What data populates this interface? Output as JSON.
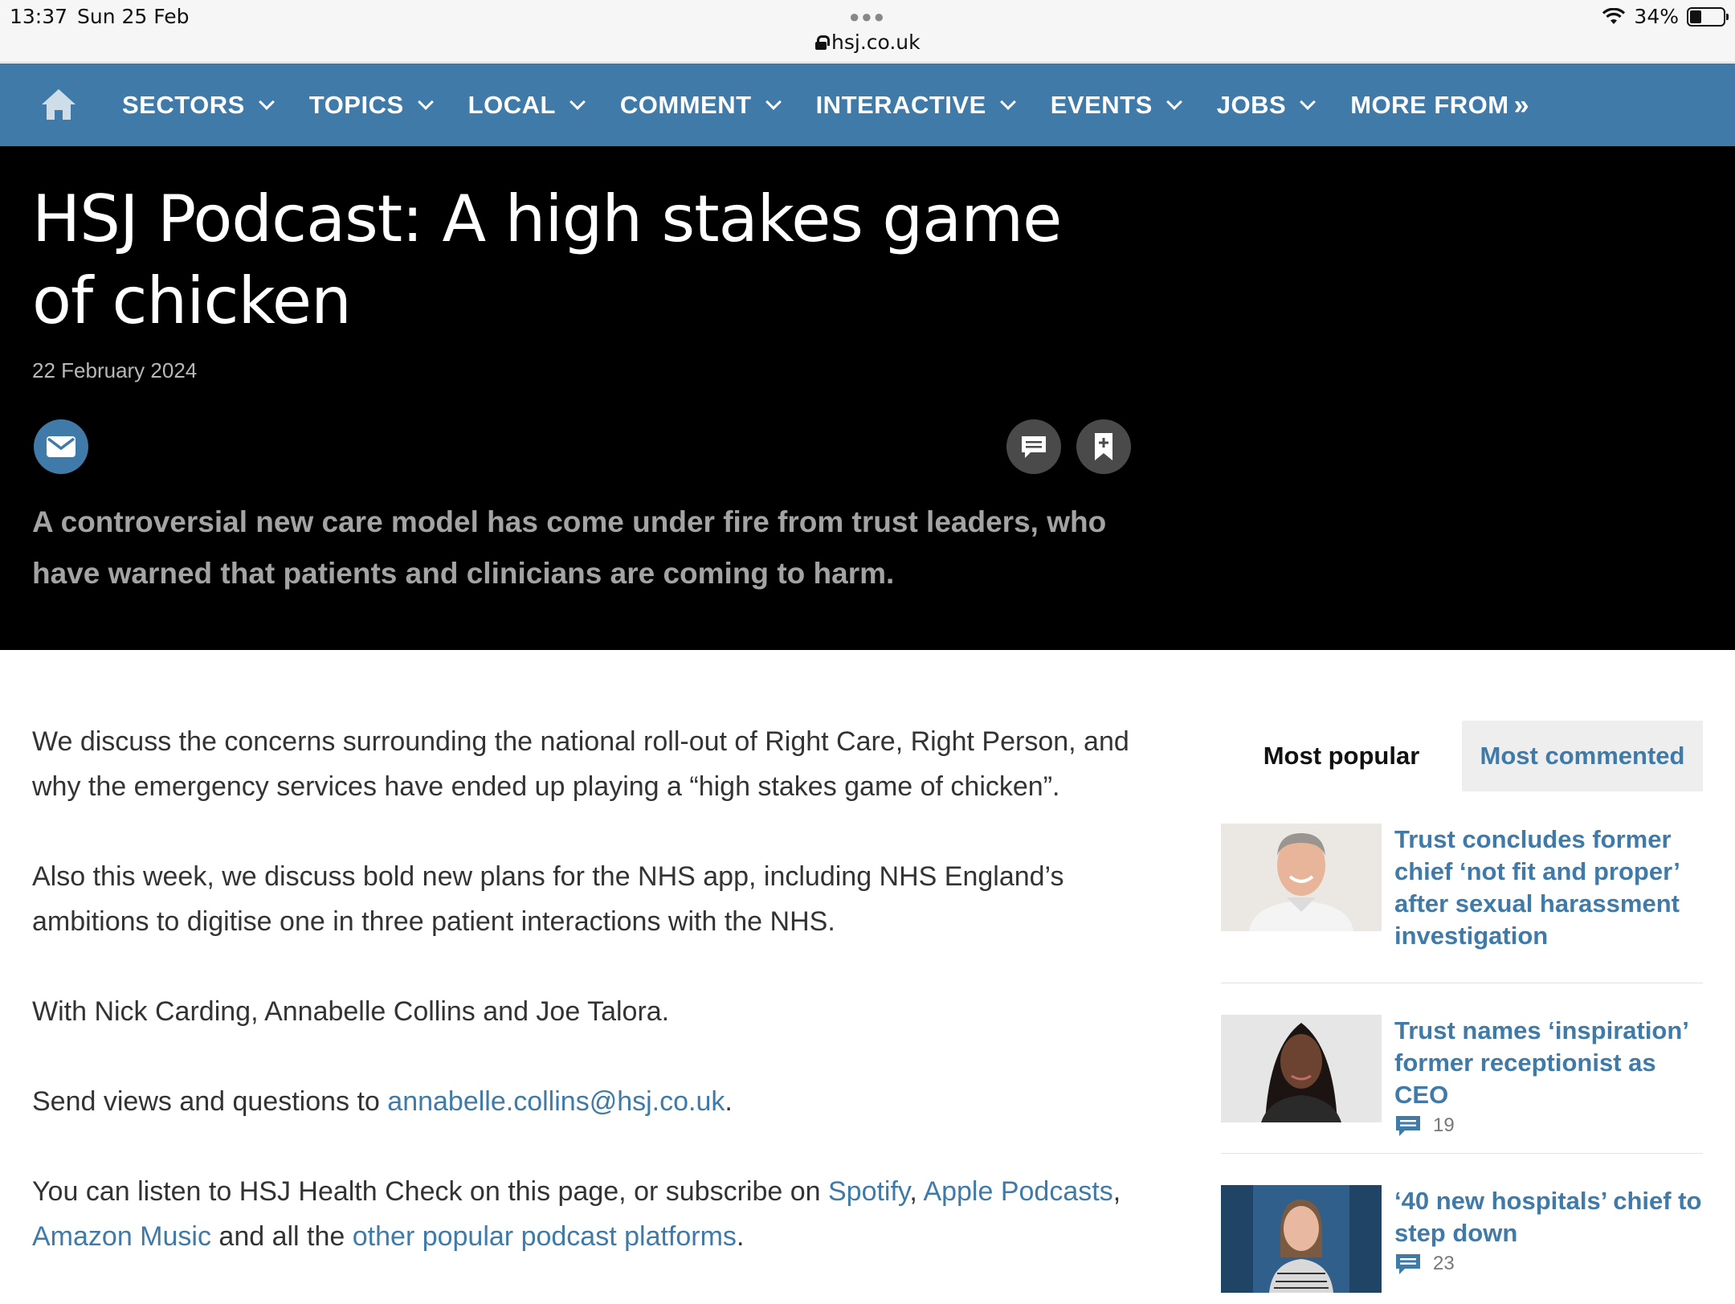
{
  "status_bar": {
    "time": "13:37",
    "date": "Sun 25 Feb",
    "url": "hsj.co.uk",
    "battery": "34%"
  },
  "nav": {
    "items": [
      "SECTORS",
      "TOPICS",
      "LOCAL",
      "COMMENT",
      "INTERACTIVE",
      "EVENTS",
      "JOBS"
    ],
    "more": "MORE FROM",
    "color": "#3f7aa8"
  },
  "article": {
    "title": "HSJ Podcast: A high stakes game of chicken",
    "date": "22 February 2024",
    "standfirst": "A controversial new care model has come under fire from trust leaders, who have warned that patients and clinicians are coming to harm.",
    "p1": "We discuss the concerns surrounding the national roll-out of Right Care, Right Person, and why the emergency services have ended up playing a “high stakes game of chicken”.",
    "p2": "Also this week, we discuss bold new plans for the NHS app, including NHS England’s ambitions to digitise one in three patient interactions with the NHS.",
    "p3": "With Nick Carding, Annabelle Collins and Joe Talora.",
    "p4_prefix": "Send views and questions to ",
    "p4_email": "annabelle.collins@hsj.co.uk",
    "p4_suffix": ".",
    "p5_prefix": "You can listen to HSJ Health Check on this page, or subscribe on ",
    "p5_spotify": "Spotify",
    "p5_comma1": ", ",
    "p5_apple": "Apple Podcasts",
    "p5_comma2": ", ",
    "p5_amazon": "Amazon Music",
    "p5_mid": " and all the ",
    "p5_other": "other popular podcast platforms",
    "p5_suffix": "."
  },
  "sidebar": {
    "tab_popular": "Most popular",
    "tab_commented": "Most commented",
    "stories": [
      {
        "headline": "Trust concludes former chief ‘not fit and proper’ after sexual harassment investigation",
        "comments": ""
      },
      {
        "headline": "Trust names ‘inspiration’ former receptionist as CEO",
        "comments": "19"
      },
      {
        "headline": "‘40 new hospitals’ chief to step down",
        "comments": "23"
      }
    ]
  }
}
